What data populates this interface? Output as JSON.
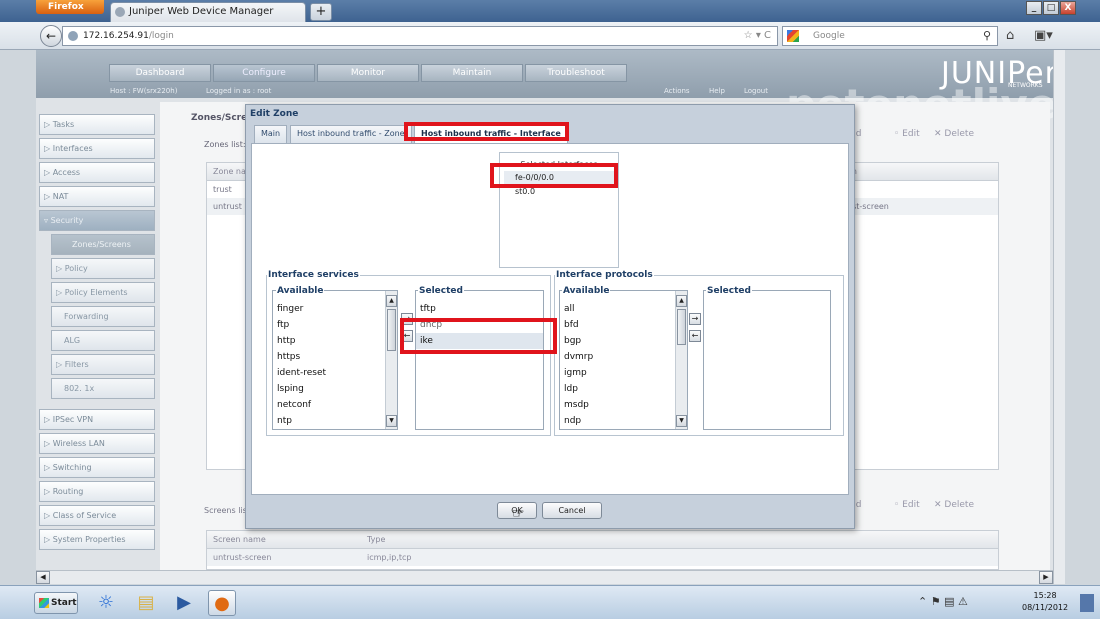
{
  "browser": {
    "menu_button": "Firefox",
    "tab_title": "Juniper Web Device Manager",
    "new_tab": "+",
    "url_host": "172.16.254.91",
    "url_path": "/login",
    "search_placeholder": "Google",
    "window_controls": [
      "_",
      "□",
      "X"
    ]
  },
  "app": {
    "top_nav": [
      "Dashboard",
      "Configure",
      "Monitor",
      "Maintain",
      "Troubleshoot"
    ],
    "host_line": "Host : FW(srx220h)",
    "logged_in": "Logged in as : root",
    "header_links": [
      "Actions",
      "Help",
      "Logout"
    ],
    "logo": "JUNIPer",
    "logo_sub": "NETWORKS",
    "watermark": "petenetlive",
    "sidebar": [
      "Tasks",
      "Interfaces",
      "Access",
      "NAT",
      "Security",
      "Zones/Screens",
      "Policy",
      "Policy Elements",
      "Forwarding",
      "ALG",
      "Filters",
      "802. 1x",
      "IPSec VPN",
      "Wireless LAN",
      "Switching",
      "Routing",
      "Class of Service",
      "System Properties"
    ],
    "pane_title": "Zones/Screens",
    "zones_label": "Zones list:",
    "zones_header": "Zone name",
    "zones_header2": "en",
    "zones_rows": [
      "trust",
      "untrust"
    ],
    "zones_screen_value": "ust-screen",
    "actions": {
      "add": "Add",
      "edit": "Edit",
      "delete": "Delete"
    },
    "screens_label": "Screens list:",
    "screens_header": [
      "Screen name",
      "Type"
    ],
    "screens_row": [
      "untrust-screen",
      "icmp,ip,tcp"
    ]
  },
  "dialog": {
    "title": "Edit Zone",
    "tabs": [
      "Main",
      "Host inbound traffic - Zone",
      "Host inbound traffic - Interface"
    ],
    "selected_interfaces_label": "Selected Interfaces",
    "selected_interfaces": [
      "fe-0/0/0.0",
      "st0.0"
    ],
    "services": {
      "legend": "Interface services",
      "available_label": "Available",
      "available": [
        "finger",
        "ftp",
        "http",
        "https",
        "ident-reset",
        "lsping",
        "netconf",
        "ntp"
      ],
      "selected_label": "Selected",
      "selected": [
        "tftp",
        "dhcp",
        "ike"
      ]
    },
    "protocols": {
      "legend": "Interface protocols",
      "available_label": "Available",
      "available": [
        "all",
        "bfd",
        "bgp",
        "dvmrp",
        "igmp",
        "ldp",
        "msdp",
        "ndp"
      ],
      "selected_label": "Selected",
      "selected": []
    },
    "ok_label": "OK",
    "cancel_label": "Cancel"
  },
  "taskbar": {
    "start": "Start",
    "time": "15:28",
    "date": "08/11/2012"
  },
  "colors": {
    "highlight_red": "#e0141c",
    "dialog_title": "#1f3f66"
  }
}
